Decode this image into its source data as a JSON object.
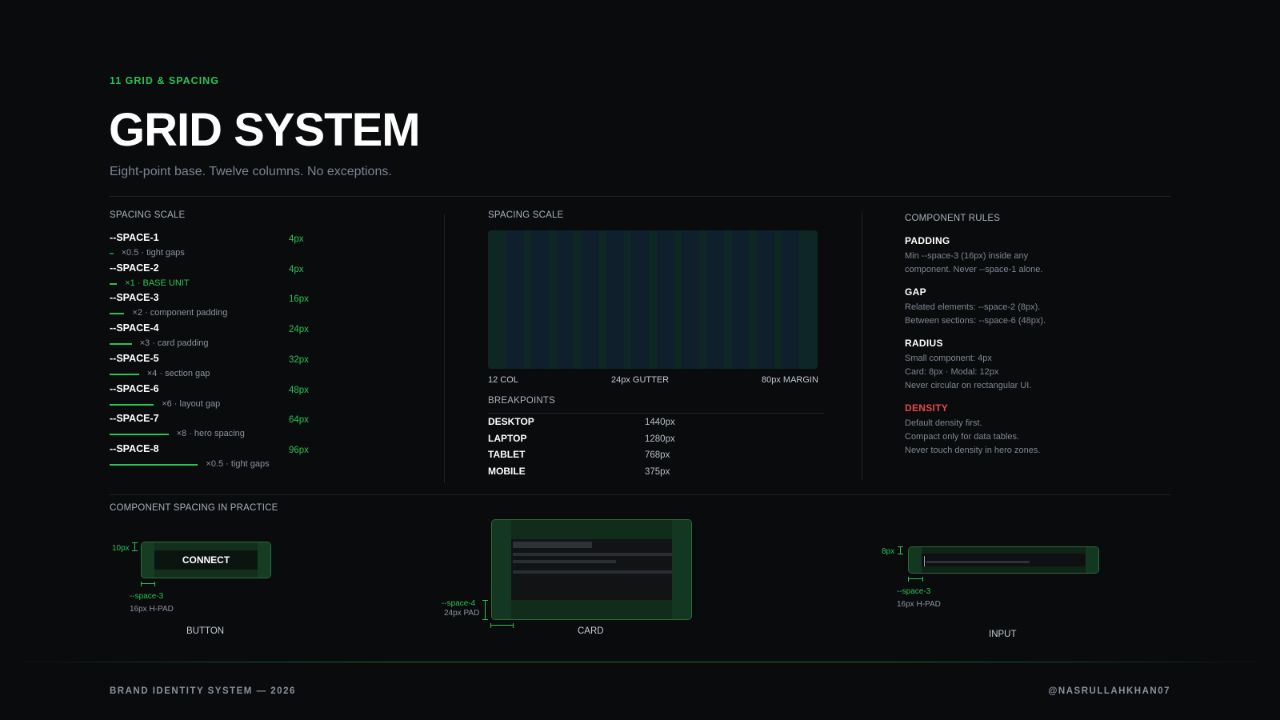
{
  "header": {
    "eyebrow": "11 GRID & SPACING",
    "title": "GRID SYSTEM",
    "subtitle": "Eight-point base. Twelve columns. No exceptions."
  },
  "spacing_scale": {
    "label": "SPACING SCALE",
    "items": [
      {
        "name": "--SPACE-1",
        "value": "4px",
        "note": "×0.5 · tight gaps",
        "ratio": 0.5
      },
      {
        "name": "--SPACE-2",
        "value": "4px",
        "note": "×1 · BASE UNIT",
        "ratio": 1
      },
      {
        "name": "--SPACE-3",
        "value": "16px",
        "note": "×2 · component padding",
        "ratio": 2
      },
      {
        "name": "--SPACE-4",
        "value": "24px",
        "note": "×3 · card padding",
        "ratio": 3
      },
      {
        "name": "--SPACE-5",
        "value": "32px",
        "note": "×4 · section gap",
        "ratio": 4
      },
      {
        "name": "--SPACE-6",
        "value": "48px",
        "note": "×6 · layout gap",
        "ratio": 6
      },
      {
        "name": "--SPACE-7",
        "value": "64px",
        "note": "×8 · hero spacing",
        "ratio": 8
      },
      {
        "name": "--SPACE-8",
        "value": "96px",
        "note": "×0.5 · tight gaps",
        "ratio": 12
      }
    ]
  },
  "grid": {
    "label": "SPACING SCALE",
    "columns_label": "12 COL",
    "gutter_label": "24px GUTTER",
    "margin_label": "80px MARGIN"
  },
  "breakpoints": {
    "label": "BREAKPOINTS",
    "items": [
      {
        "name": "DESKTOP",
        "value": "1440px"
      },
      {
        "name": "LAPTOP",
        "value": "1280px"
      },
      {
        "name": "TABLET",
        "value": "768px"
      },
      {
        "name": "MOBILE",
        "value": "375px"
      }
    ]
  },
  "rules": {
    "label": "COMPONENT RULES",
    "items": [
      {
        "heading": "PADDING",
        "lines": [
          "Min --space-3 (16px) inside any",
          "component. Never --space-1 alone."
        ]
      },
      {
        "heading": "GAP",
        "lines": [
          "Related elements: --space-2 (8px).",
          "Between sections: --space-6 (48px)."
        ]
      },
      {
        "heading": "RADIUS",
        "lines": [
          "Small component: 4px",
          "Card: 8px · Modal: 12px",
          "Never circular on rectangular UI."
        ]
      },
      {
        "heading": "DENSITY",
        "lines": [
          "Default density first.",
          "Compact only for data tables.",
          "Never touch density in hero zones."
        ]
      }
    ]
  },
  "practice": {
    "label": "COMPONENT SPACING IN PRACTICE",
    "button": {
      "text": "CONNECT",
      "v_pad": "10px",
      "token": "--space-3",
      "desc": "16px H-PAD",
      "caption": "BUTTON"
    },
    "card": {
      "token": "--space-4",
      "desc": "24px PAD",
      "caption": "CARD"
    },
    "input": {
      "v_pad": "8px",
      "token": "--space-3",
      "desc": "16px H-PAD",
      "caption": "INPUT"
    }
  },
  "footer": {
    "left": "BRAND IDENTITY SYSTEM — 2026",
    "right": "@NASRULLAHKHAN07"
  },
  "colors": {
    "accent": "#28c255",
    "danger": "#e5484d",
    "background": "#0a0b0d"
  }
}
